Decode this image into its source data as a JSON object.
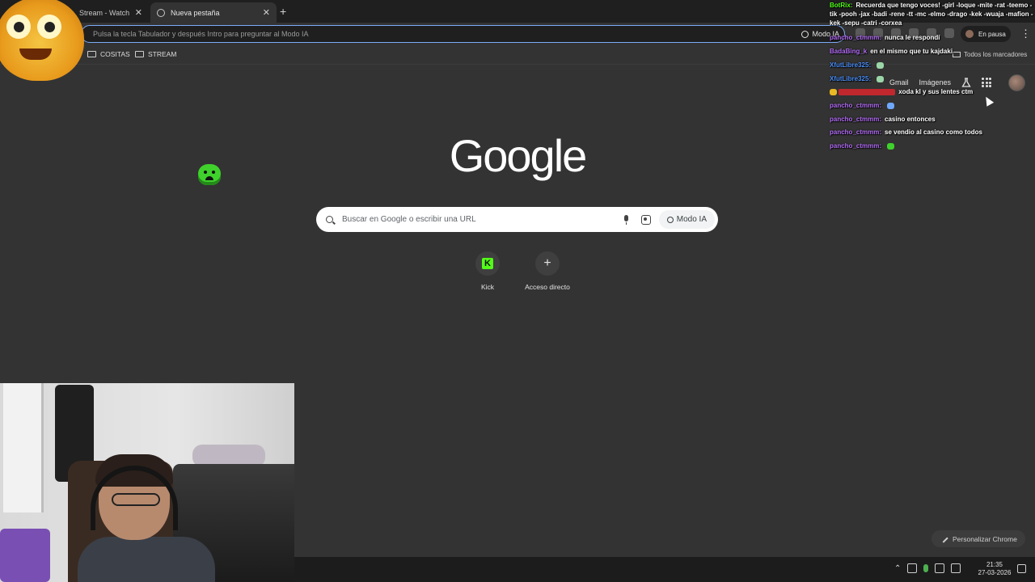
{
  "browser": {
    "tabs": [
      {
        "title": "Stream - Watch Li",
        "active": false
      },
      {
        "title": "Nueva pestaña",
        "active": true
      }
    ],
    "omnibox_placeholder": "Pulsa la tecla Tabulador y después Intro para preguntar al Modo IA",
    "omnibox_ai_label": "Modo IA",
    "pause_label": "En pausa",
    "bookmarks": [
      "COSITAS",
      "STREAM"
    ],
    "all_bookmarks_label": "Todos los marcadores"
  },
  "ntp": {
    "links": {
      "gmail": "Gmail",
      "images": "Imágenes"
    },
    "logo_text": "Google",
    "search_placeholder": "Buscar en Google o escribir una URL",
    "search_ai_label": "Modo IA",
    "shortcuts": [
      {
        "label": "Kick",
        "icon": "kick-icon"
      },
      {
        "label": "Acceso directo",
        "icon": "plus-icon"
      }
    ],
    "customize_label": "Personalizar Chrome"
  },
  "taskbar": {
    "time": "21:35",
    "date": "27-03-2026"
  },
  "chat": {
    "botrix": {
      "user": "BotRix:",
      "message": "Recuerda que tengo voces! -girl -loque -mite -rat -teemo -tik -pooh -jax -badi -rene -tt -mc -elmo -drago -kek -wuaja -mafion -kek -sepu -catri -corxea"
    },
    "messages": [
      {
        "user": "pancho_ctmmm:",
        "message": "nunca le respondí",
        "color": "#b26cf5"
      },
      {
        "user": "BadaBing_k",
        "message": "en el mismo que tu kajdaki",
        "color": "#b26cf5"
      },
      {
        "user": "XfutLibre325:",
        "message": "",
        "color": "#4a8df5"
      },
      {
        "user": "XfutLibre325:",
        "message": "",
        "color": "#4a8df5"
      },
      {
        "user": "",
        "message": "xoda kl y sus lentes ctm",
        "color": "#e83a3a"
      },
      {
        "user": "pancho_ctmmm:",
        "message": "",
        "color": "#b26cf5"
      },
      {
        "user": "pancho_ctmmm:",
        "message": "casino entonces",
        "color": "#b26cf5"
      },
      {
        "user": "pancho_ctmmm:",
        "message": "se vendio al casino como todos",
        "color": "#b26cf5"
      },
      {
        "user": "pancho_ctmmm:",
        "message": "",
        "color": "#b26cf5"
      }
    ]
  },
  "colors": {
    "background": "#333333",
    "tabstrip": "#1f1f1f",
    "omnibox_focus": "#7cacf8",
    "kick_green": "#53fc18"
  }
}
